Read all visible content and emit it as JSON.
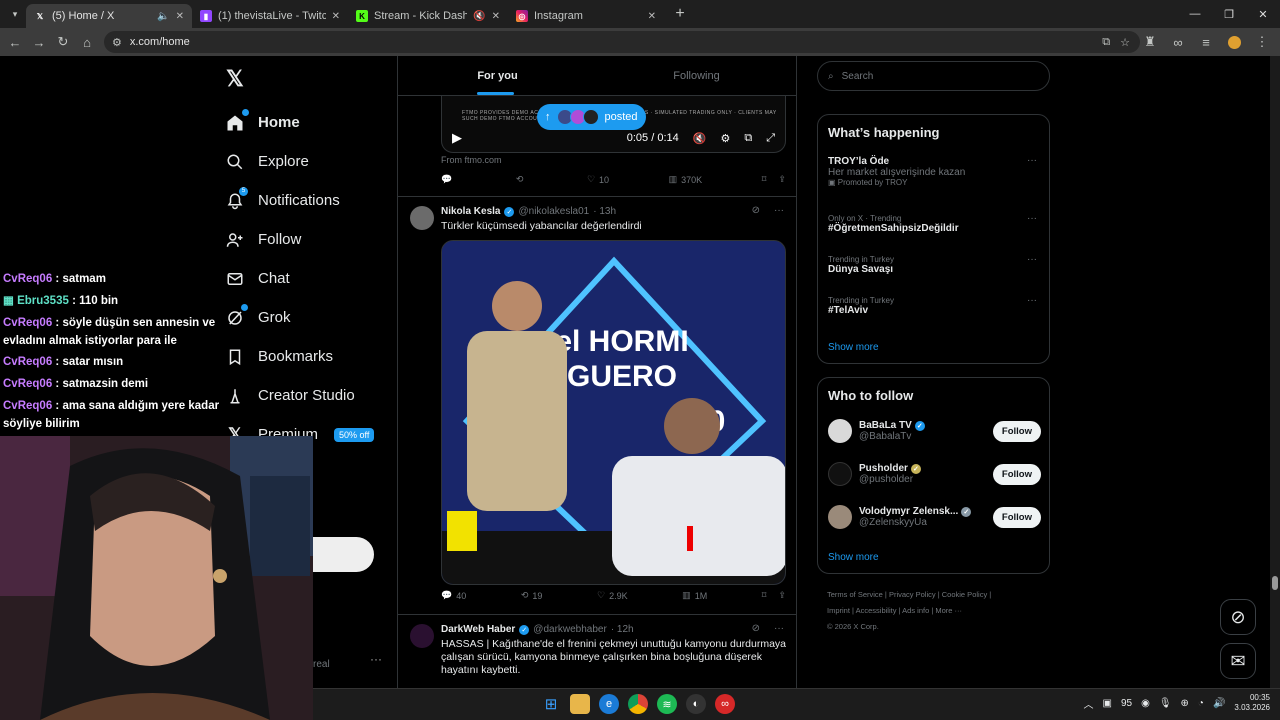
{
  "browser": {
    "tabs": [
      {
        "title": "(5) Home / X",
        "favicon": "x-logo-icon"
      },
      {
        "title": "(1) thevistaLive - Twitch",
        "favicon": "twitch-icon"
      },
      {
        "title": "Stream - Kick Dashboard",
        "favicon": "kick-icon"
      },
      {
        "title": "Instagram",
        "favicon": "instagram-icon"
      }
    ],
    "url": "x.com/home"
  },
  "x_nav": {
    "items": [
      {
        "label": "Home"
      },
      {
        "label": "Explore"
      },
      {
        "label": "Notifications",
        "badge": "5"
      },
      {
        "label": "Follow"
      },
      {
        "label": "Chat"
      },
      {
        "label": "Grok"
      },
      {
        "label": "Bookmarks"
      },
      {
        "label": "Creator Studio"
      },
      {
        "label": "Premium",
        "badge": "50% off"
      }
    ]
  },
  "feed": {
    "tabs": [
      "For you",
      "Following"
    ],
    "video": {
      "time": "0:05 / 0:14",
      "overlay_text": "FTMO PROVIDES DEMO ACCOUNTS · EARN MONETARY REWARDS · SIMULATED TRADING ONLY · CLIENTS MAY SUCH DEMO FTMO ACCOUNT"
    },
    "posted_pill": "posted",
    "from": "From ftmo.com",
    "tweet0_actions": {
      "reply": "",
      "retweet": "",
      "like": "10",
      "views": "370K"
    },
    "tweet1": {
      "name": "Nikola Kesla",
      "handle": "@nikolakesla01",
      "time": "· 13h",
      "text": "Türkler küçümsedi yabancılar değerlendirdi",
      "media_title_1": "el HORMI",
      "media_title_2": "GUERO",
      "media_year": "20",
      "actions": {
        "reply": "40",
        "retweet": "19",
        "like": "2.9K",
        "views": "1M"
      }
    },
    "tweet2": {
      "name": "DarkWeb Haber",
      "handle": "@darkwebhaber",
      "time": "· 12h",
      "text": "HASSAS | Kağıthane'de el frenini çekmeyi unuttuğu kamyonu durdurmaya çalışan sürücü, kamyona binmeye çalışırken bina boşluğuna düşerek hayatını kaybetti."
    }
  },
  "sidebar": {
    "search_placeholder": "Search",
    "whats_happening": {
      "title": "What’s happening",
      "trends": [
        {
          "title": "TROY’la Öde",
          "sub": "Her market alışverişinde kazan",
          "promo": "Promoted by TROY"
        },
        {
          "context": "Only on X · Trending",
          "title": "#ÖğretmenSahipsizDeğildir"
        },
        {
          "context": "Trending in Turkey",
          "title": "Dünya Savaşı"
        },
        {
          "context": "Trending in Turkey",
          "title": "#TelAviv"
        }
      ],
      "show_more": "Show more"
    },
    "who_to_follow": {
      "title": "Who to follow",
      "accounts": [
        {
          "name": "BaBaLa TV",
          "handle": "@BabalaTv",
          "button": "Follow"
        },
        {
          "name": "Pusholder",
          "handle": "@pusholder",
          "button": "Follow"
        },
        {
          "name": "Volodymyr Zelensk...",
          "handle": "@ZelenskyyUa",
          "button": "Follow"
        }
      ],
      "show_more": "Show more"
    },
    "footer": {
      "line1": "Terms of Service  |  Privacy Policy  |  Cookie Policy  |",
      "line2": "Imprint  |  Accessibility  |  Ads info  |  More ···",
      "line3": "© 2026 X Corp."
    }
  },
  "stream_chat": [
    {
      "user": "CvReq06",
      "msg": ": satmam",
      "color": "#c67cff"
    },
    {
      "user": "Ebru3535",
      "msg": ": 110 bin",
      "color": "#5ee0c6"
    },
    {
      "user": "CvReq06",
      "msg": ": söyle düşün sen annesin ve evladını almak istiyorlar para ile",
      "color": "#c67cff"
    },
    {
      "user": "CvReq06",
      "msg": ": satar mısın",
      "color": "#c67cff"
    },
    {
      "user": "CvReq06",
      "msg": ": satmazsin demi",
      "color": "#c67cff"
    },
    {
      "user": "CvReq06",
      "msg": ": ama sana aldığım yere kadar söyliye bilirim",
      "color": "#c67cff"
    }
  ],
  "misc": {
    "partial_text": "real"
  },
  "taskbar": {
    "weather": "95",
    "time": "00:35",
    "date": "3.03.2026"
  },
  "colors": {
    "accent": "#1d9bf0",
    "background": "#000000",
    "text": "#e7e9ea",
    "muted": "#71767b"
  }
}
